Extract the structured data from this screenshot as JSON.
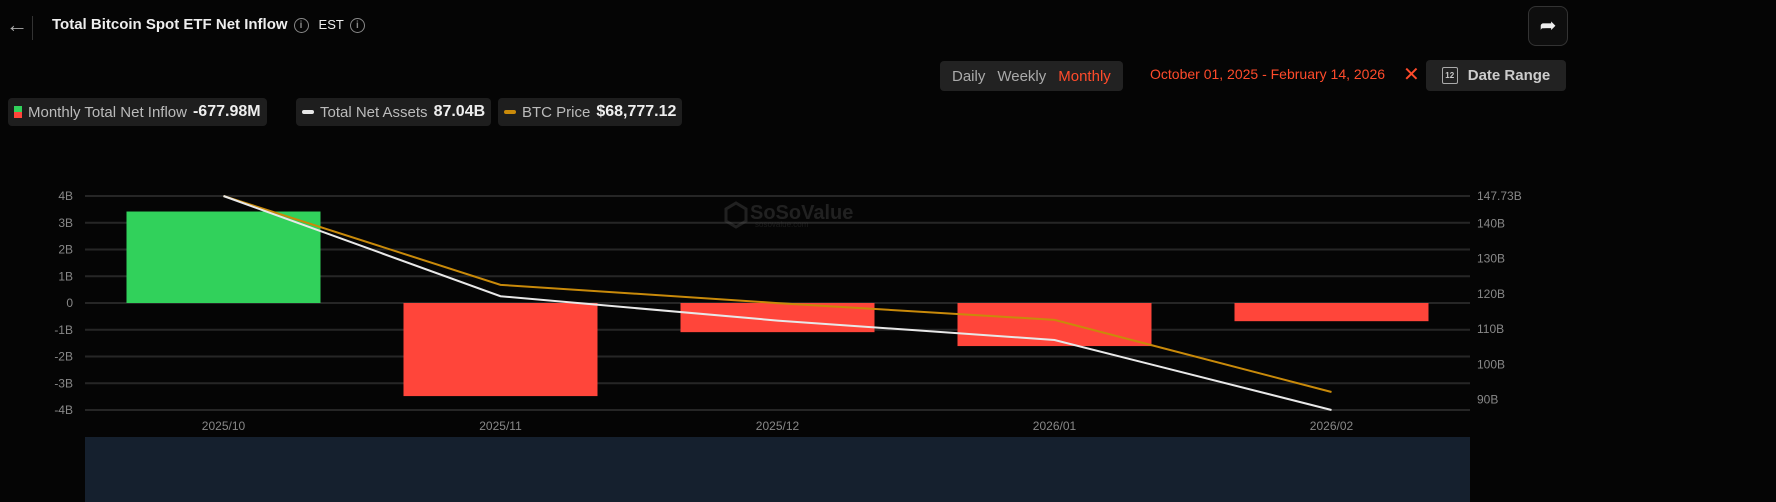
{
  "header": {
    "title": "Total Bitcoin Spot ETF Net Inflow",
    "timezone": "EST",
    "share_icon": "share-icon",
    "back_icon": "back-arrow-icon"
  },
  "period_tabs": [
    {
      "label": "Daily"
    },
    {
      "label": "Weekly"
    },
    {
      "label": "Monthly",
      "active": true
    }
  ],
  "date_range": {
    "text": "October 01, 2025 - February 14, 2026",
    "button_label": "Date Range",
    "calendar_day": "12"
  },
  "legend": [
    {
      "label": "Monthly Total Net Inflow",
      "value": "-677.98M"
    },
    {
      "label": "Total Net Assets",
      "value": "87.04B"
    },
    {
      "label": "BTC Price",
      "value": "$68,777.12"
    }
  ],
  "watermark": {
    "brand": "SoSoValue",
    "site": "sosovalue.com"
  },
  "colors": {
    "positive": "#31d15b",
    "negative": "#ff453a",
    "assets": "#e8e8e8",
    "price": "#c98a0a",
    "accent": "#ff4b2b"
  },
  "chart_data": {
    "type": "bar",
    "categories": [
      "2025/10",
      "2025/11",
      "2025/12",
      "2026/01",
      "2026/02"
    ],
    "series": [
      {
        "name": "Monthly Total Net Inflow",
        "unit": "B USD",
        "axis": "left",
        "values": [
          3.42,
          -3.48,
          -1.09,
          -1.61,
          -0.68
        ]
      },
      {
        "name": "Total Net Assets",
        "unit": "B USD",
        "axis": "right",
        "type": "line",
        "values": [
          147.73,
          119.3,
          112.4,
          106.9,
          87.04
        ]
      },
      {
        "name": "BTC Price",
        "unit": "USD",
        "axis": "hidden",
        "type": "line",
        "values": [
          109600,
          91100,
          87300,
          83800,
          68777.12
        ]
      }
    ],
    "left_axis": {
      "ticks": [
        "4B",
        "3B",
        "2B",
        "1B",
        "0",
        "-1B",
        "-2B",
        "-3B",
        "-4B"
      ],
      "ylim": [
        -4,
        4
      ]
    },
    "right_axis": {
      "ticks": [
        "147.73B",
        "140B",
        "130B",
        "120B",
        "110B",
        "100B",
        "90B"
      ],
      "ylim": [
        87.04,
        147.73
      ]
    },
    "price_range": [
      68777.12,
      109600
    ],
    "grid": true
  }
}
